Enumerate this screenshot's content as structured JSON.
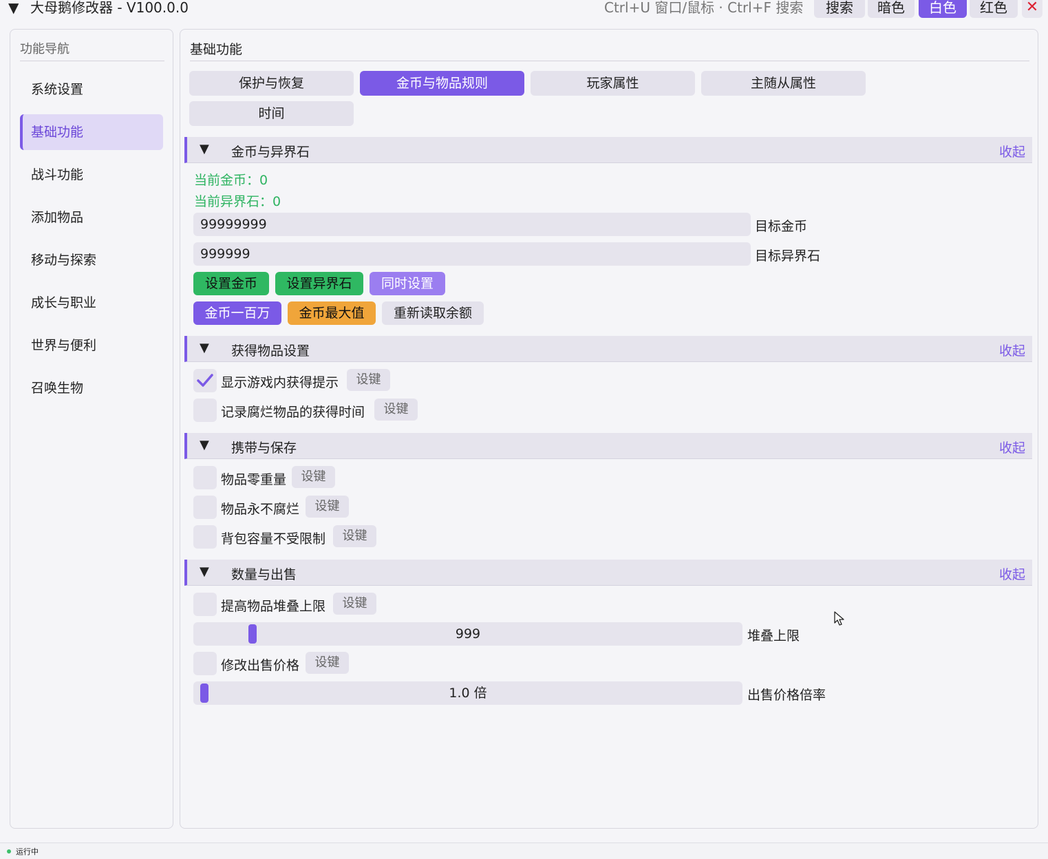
{
  "window": {
    "title": "大母鹅修改器 - V100.0.0",
    "hint": "Ctrl+U 窗口/鼠标 · Ctrl+F 搜索",
    "buttons": {
      "search": "搜索",
      "dark": "暗色",
      "white": "白色",
      "red": "红色",
      "close": "✕"
    }
  },
  "sidebar": {
    "title": "功能导航",
    "items": [
      {
        "label": "系统设置"
      },
      {
        "label": "基础功能"
      },
      {
        "label": "战斗功能"
      },
      {
        "label": "添加物品"
      },
      {
        "label": "移动与探索"
      },
      {
        "label": "成长与职业"
      },
      {
        "label": "世界与便利"
      },
      {
        "label": "召唤生物"
      }
    ]
  },
  "main": {
    "title": "基础功能",
    "tabs": [
      {
        "label": "保护与恢复"
      },
      {
        "label": "金币与物品规则"
      },
      {
        "label": "玩家属性"
      },
      {
        "label": "主随从属性"
      },
      {
        "label": "时间"
      }
    ],
    "fold_label": "收起",
    "key_label": "设键",
    "sections": {
      "gold": {
        "title": "金币与异界石",
        "current_gold": "当前金币：0",
        "current_stone": "当前异界石：0",
        "gold_input": "99999999",
        "gold_input_label": "目标金币",
        "stone_input": "999999",
        "stone_input_label": "目标异界石",
        "btn_set_gold": "设置金币",
        "btn_set_stone": "设置异界石",
        "btn_set_both": "同时设置",
        "btn_million": "金币一百万",
        "btn_max": "金币最大值",
        "btn_reload": "重新读取余额"
      },
      "obtain": {
        "title": "获得物品设置",
        "opt1": "显示游戏内获得提示",
        "opt1_checked": true,
        "opt2": "记录腐烂物品的获得时间",
        "opt2_checked": false
      },
      "carry": {
        "title": "携带与保存",
        "opt1": "物品零重量",
        "opt2": "物品永不腐烂",
        "opt3": "背包容量不受限制"
      },
      "quantity": {
        "title": "数量与出售",
        "opt1": "提高物品堆叠上限",
        "stack_value": "999",
        "stack_label": "堆叠上限",
        "opt2": "修改出售价格",
        "price_value": "1.0 倍",
        "price_label": "出售价格倍率"
      }
    }
  },
  "status": {
    "text": "运行中",
    "color": "#3cbf6a"
  },
  "colors": {
    "accent": "#7b5ae6",
    "green": "#2fb862",
    "orange": "#f0a53a"
  }
}
